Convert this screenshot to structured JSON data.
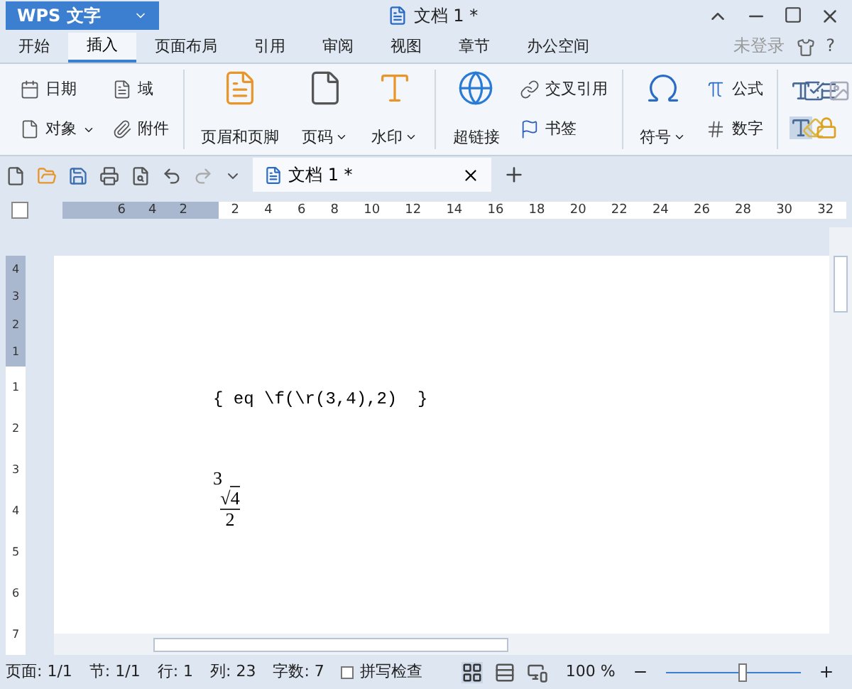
{
  "title_bar": {
    "app_menu": "WPS 文字",
    "doc_title": "文档 1 *"
  },
  "menu_tabs": [
    {
      "label": "开始",
      "selected": false
    },
    {
      "label": "插入",
      "selected": true
    },
    {
      "label": "页面布局",
      "selected": false
    },
    {
      "label": "引用",
      "selected": false
    },
    {
      "label": "审阅",
      "selected": false
    },
    {
      "label": "视图",
      "selected": false
    },
    {
      "label": "章节",
      "selected": false
    },
    {
      "label": "办公空间",
      "selected": false
    }
  ],
  "account": "未登录",
  "help": "?",
  "ribbon": [
    {
      "kind": "small",
      "items": [
        {
          "label": "日期",
          "dropdown": false
        },
        {
          "label": "对象",
          "dropdown": true
        }
      ]
    },
    {
      "kind": "small",
      "items": [
        {
          "label": "域",
          "dropdown": false
        },
        {
          "label": "附件",
          "dropdown": false
        }
      ]
    },
    {
      "kind": "divider"
    },
    {
      "kind": "large",
      "items": [
        {
          "label": "页眉和页脚",
          "dropdown": false
        }
      ]
    },
    {
      "kind": "large",
      "items": [
        {
          "label": "页码",
          "dropdown": true
        }
      ]
    },
    {
      "kind": "large",
      "items": [
        {
          "label": "水印",
          "dropdown": true
        }
      ]
    },
    {
      "kind": "divider"
    },
    {
      "kind": "large",
      "items": [
        {
          "label": "超链接",
          "dropdown": false
        }
      ]
    },
    {
      "kind": "small",
      "items": [
        {
          "label": "交叉引用",
          "dropdown": false
        },
        {
          "label": "书签",
          "dropdown": false
        }
      ]
    },
    {
      "kind": "divider"
    },
    {
      "kind": "large",
      "items": [
        {
          "label": "符号",
          "dropdown": true
        }
      ]
    },
    {
      "kind": "small",
      "items": [
        {
          "label": "公式",
          "dropdown": false
        },
        {
          "label": "数字",
          "dropdown": false
        }
      ]
    },
    {
      "kind": "divider"
    },
    {
      "kind": "icons"
    }
  ],
  "doc_tabs": [
    {
      "label": "文档 1 *",
      "selected": true
    }
  ],
  "ruler": {
    "left_ticks": [
      "6",
      "4",
      "2"
    ],
    "right_ticks": [
      "2",
      "4",
      "6",
      "8",
      "10",
      "12",
      "14",
      "16",
      "18",
      "20",
      "22",
      "24",
      "26",
      "28",
      "30",
      "32"
    ]
  },
  "vertical_ruler": {
    "top_ticks": [
      "4",
      "3",
      "2",
      "1"
    ],
    "bottom_ticks": [
      "1",
      "2",
      "3",
      "4",
      "5",
      "6",
      "7"
    ]
  },
  "document": {
    "field_code": "{ eq \\f(\\r(3,4),2)  }",
    "equation": {
      "index": "3",
      "radical": "√",
      "radicand": "4",
      "denominator": "2"
    }
  },
  "status_bar": {
    "items": [
      "页面: 1/1",
      "节: 1/1",
      "行: 1",
      "列: 23",
      "字数: 7"
    ],
    "spell_check": {
      "label": "拼写检查",
      "checked": false
    },
    "views": [
      {
        "kind": "page",
        "selected": true
      },
      {
        "kind": "outline",
        "selected": false
      },
      {
        "kind": "web",
        "selected": false
      }
    ],
    "zoom": "100 %",
    "zoom_level": {
      "level": 0.57
    }
  }
}
